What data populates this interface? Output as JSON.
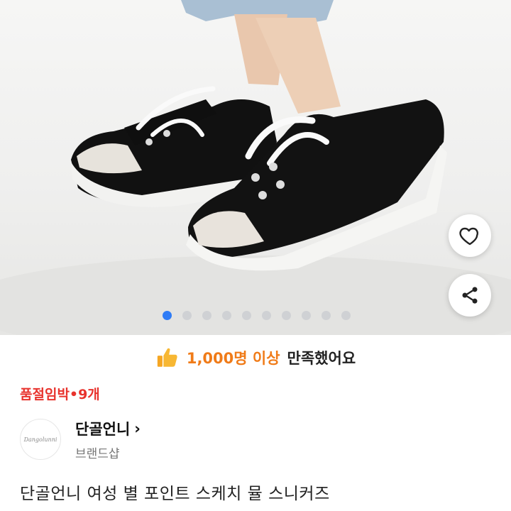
{
  "gallery": {
    "total_images": 10,
    "current_index": 1,
    "like_icon": "heart-icon",
    "share_icon": "share-icon"
  },
  "satisfaction": {
    "icon": "thumbs-up-icon",
    "count_text": "1,000명 이상",
    "suffix_text": "만족했어요"
  },
  "stock": {
    "text": "품절임박•9개",
    "color": "#e8332d"
  },
  "seller": {
    "name": "단골언니",
    "arrow": "›",
    "type": "브랜드샵",
    "logo_text": "Dangolunni"
  },
  "product": {
    "title": "단골언니 여성 별 포인트 스케치 뮬 스니커즈"
  },
  "colors": {
    "accent_orange": "#f07b18",
    "accent_blue": "#2f7cf6",
    "stock_red": "#e8332d"
  }
}
